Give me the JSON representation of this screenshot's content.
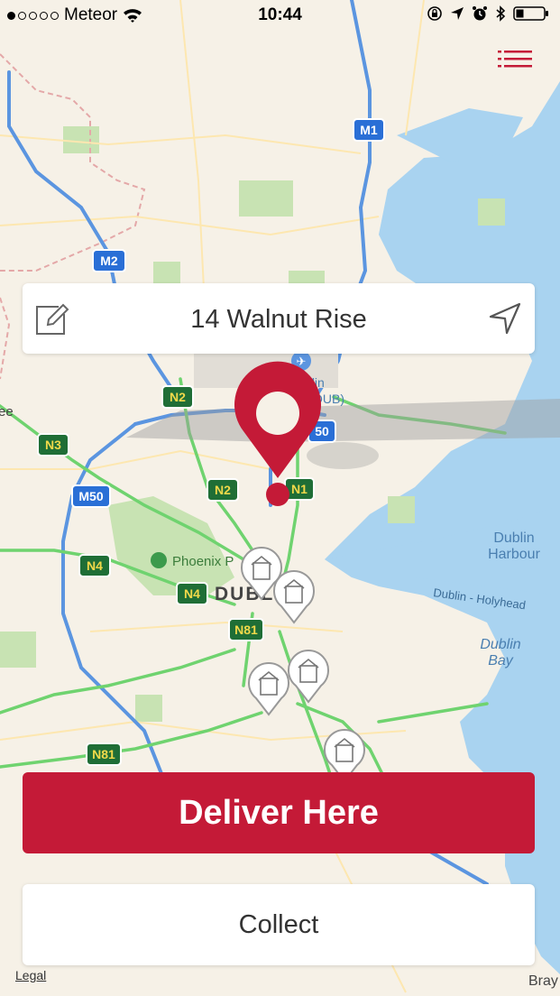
{
  "status_bar": {
    "carrier": "Meteor",
    "time": "10:44"
  },
  "address_bar": {
    "address": "14 Walnut Rise"
  },
  "actions": {
    "deliver_label": "Deliver Here",
    "collect_label": "Collect"
  },
  "map": {
    "legal_label": "Legal",
    "labels": {
      "dublin_harbour_1": "Dublin",
      "dublin_harbour_2": "Harbour",
      "dublin_bay_1": "Dublin",
      "dublin_bay_2": "Bay",
      "ferry_route": "Dublin - Holyhead",
      "airport_1": "Dublin",
      "airport_2": "Airport (DUB)",
      "phoenix_park": "Phoenix P",
      "city": "DUBL",
      "bray": "Bray",
      "left_edge": "ee"
    },
    "road_shields": {
      "m1": "M1",
      "m2": "M2",
      "m50": "M50",
      "n1": "N1",
      "n2a": "N2",
      "n2b": "N2",
      "n3": "N3",
      "n4a": "N4",
      "n4b": "N4",
      "n81a": "N81",
      "n81b": "N81",
      "n50": "50"
    }
  },
  "colors": {
    "brand_red": "#c41a37",
    "water": "#a9d3f0",
    "land": "#f6f1e7",
    "motorway": "#5b95e0",
    "national_road": "#6fd36f"
  }
}
